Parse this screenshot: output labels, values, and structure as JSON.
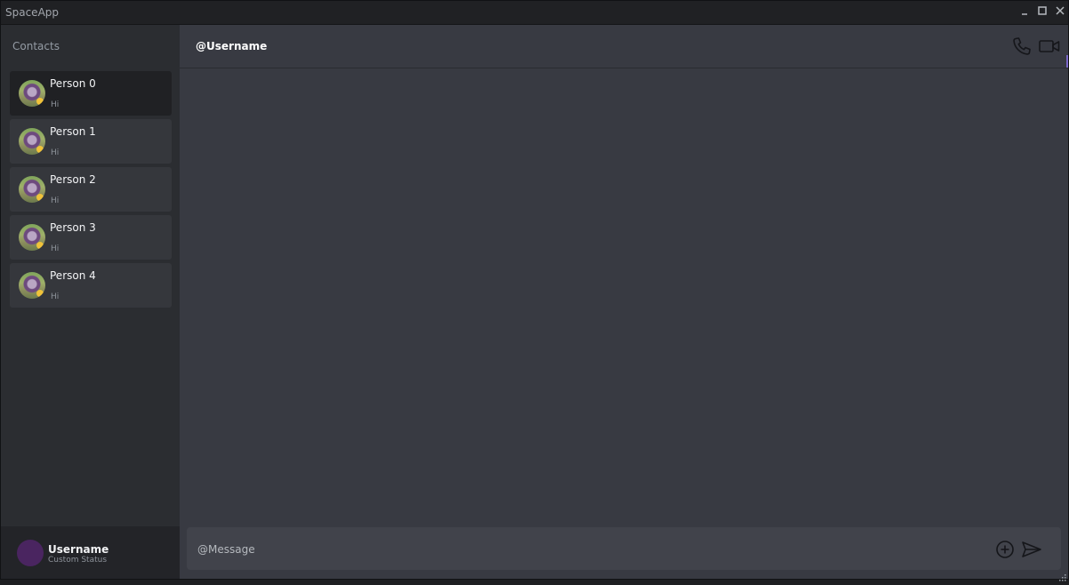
{
  "app": {
    "title": "SpaceApp"
  },
  "window_controls": {
    "minimize": "_",
    "maximize": "☐",
    "close": "✕"
  },
  "sidebar": {
    "header": "Contacts",
    "contacts": [
      {
        "name": "Person 0",
        "last_message": "Hi",
        "active": true
      },
      {
        "name": "Person 1",
        "last_message": "Hi"
      },
      {
        "name": "Person 2",
        "last_message": "Hi"
      },
      {
        "name": "Person 3",
        "last_message": "Hi"
      },
      {
        "name": "Person 4",
        "last_message": "Hi"
      }
    ],
    "user": {
      "name": "Username",
      "status": "Custom Status"
    }
  },
  "chat": {
    "title": "@Username",
    "icons": [
      "phone-icon",
      "video-camera-icon"
    ],
    "composer": {
      "placeholder": "@Message",
      "value": "",
      "icons": [
        "add-circle-icon",
        "send-icon"
      ]
    }
  },
  "colors": {
    "sidebar_bg": "#2b2d31",
    "main_bg": "#383a42",
    "contact_bg": "#35373c",
    "contact_active_bg": "#202124",
    "composer_bg": "#41434b",
    "accent": "#7a67c9"
  }
}
